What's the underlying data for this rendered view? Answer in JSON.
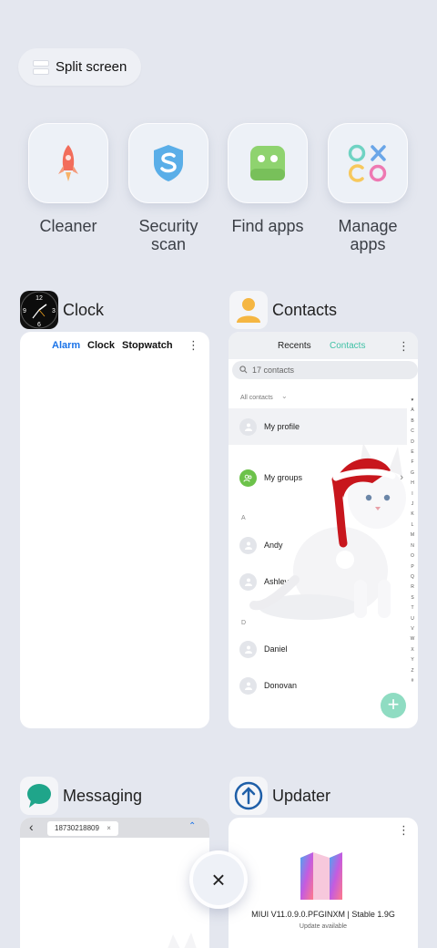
{
  "split_screen": {
    "label": "Split screen"
  },
  "quick_actions": [
    {
      "line1": "Cleaner",
      "line2": "",
      "icon": "rocket-icon"
    },
    {
      "line1": "Security",
      "line2": "scan",
      "icon": "shield-icon"
    },
    {
      "line1": "Find apps",
      "line2": "",
      "icon": "android-icon"
    },
    {
      "line1": "Manage",
      "line2": "apps",
      "icon": "shapes-icon"
    }
  ],
  "recents": {
    "clock": {
      "title": "Clock",
      "tabs": [
        "Alarm",
        "Clock",
        "Stopwatch"
      ],
      "dial": [
        "12",
        "3",
        "6",
        "9"
      ]
    },
    "contacts": {
      "title": "Contacts",
      "tabs": [
        "Recents",
        "Contacts"
      ],
      "search_placeholder": "17 contacts",
      "filter": "All contacts",
      "my_profile": "My profile",
      "my_groups": "My groups",
      "section_a": "A",
      "section_d": "D",
      "names": [
        "Andy",
        "Ashley",
        "Daniel",
        "Donovan"
      ],
      "index_letters": [
        "♥",
        "A",
        "B",
        "C",
        "D",
        "E",
        "F",
        "G",
        "H",
        "I",
        "J",
        "K",
        "L",
        "M",
        "N",
        "O",
        "P",
        "Q",
        "R",
        "S",
        "T",
        "U",
        "V",
        "W",
        "X",
        "Y",
        "Z",
        "#"
      ],
      "fab": "+"
    },
    "messaging": {
      "title": "Messaging",
      "recipient": "18730218809",
      "chip_close": "×"
    },
    "updater": {
      "title": "Updater",
      "version": "MIUI V11.0.9.0.PFGINXM | Stable 1.9G",
      "status": "Update available",
      "logo_text": "11"
    }
  },
  "close_button": {
    "symbol": "×"
  },
  "colors": {
    "background": "#e4e7ef",
    "accent_blue": "#1a73e8",
    "accent_teal": "#3fc1a5"
  }
}
